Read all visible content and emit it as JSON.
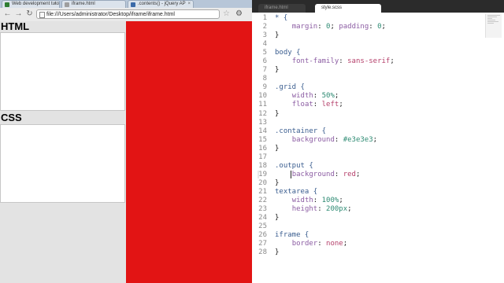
{
  "browser": {
    "tabs": [
      {
        "label": "Web development tuto",
        "favicon_color": "#2e7d32",
        "active": false
      },
      {
        "label": "iframe.html",
        "favicon_color": "#9e9e9e",
        "active": false
      },
      {
        "label": ".contents() - jQuery AP",
        "favicon_color": "#3b6aa8",
        "active": true
      }
    ],
    "tab_close": "×",
    "nav": {
      "back": "←",
      "forward": "→",
      "reload": "↻"
    },
    "url": "file:///Users/administrator/Desktop/iframe/iframe.html",
    "bookmark_icon": "☆",
    "menu_icon": "⚙"
  },
  "page": {
    "html_heading": "HTML",
    "css_heading": "CSS",
    "container_bg": "#e3e3e3",
    "output_bg": "#e21414"
  },
  "editor": {
    "tabs": [
      {
        "label": "iframe.html",
        "active": false
      },
      {
        "label": "style.scss",
        "active": true
      }
    ],
    "lines": [
      [
        {
          "t": "* {",
          "c": "sel"
        }
      ],
      [
        {
          "t": "    "
        },
        {
          "t": "margin",
          "c": "prop"
        },
        {
          "t": ": "
        },
        {
          "t": "0",
          "c": "num"
        },
        {
          "t": "; "
        },
        {
          "t": "padding",
          "c": "prop"
        },
        {
          "t": ": "
        },
        {
          "t": "0",
          "c": "num"
        },
        {
          "t": ";"
        }
      ],
      [
        {
          "t": "}"
        }
      ],
      [
        {
          "t": ""
        }
      ],
      [
        {
          "t": "body {",
          "c": "sel"
        }
      ],
      [
        {
          "t": "    "
        },
        {
          "t": "font-family",
          "c": "prop"
        },
        {
          "t": ": "
        },
        {
          "t": "sans-serif",
          "c": "val"
        },
        {
          "t": ";"
        }
      ],
      [
        {
          "t": "}"
        }
      ],
      [
        {
          "t": ""
        }
      ],
      [
        {
          "t": ".grid {",
          "c": "sel"
        }
      ],
      [
        {
          "t": "    "
        },
        {
          "t": "width",
          "c": "prop"
        },
        {
          "t": ": "
        },
        {
          "t": "50%",
          "c": "num"
        },
        {
          "t": ";"
        }
      ],
      [
        {
          "t": "    "
        },
        {
          "t": "float",
          "c": "prop"
        },
        {
          "t": ": "
        },
        {
          "t": "left",
          "c": "val"
        },
        {
          "t": ";"
        }
      ],
      [
        {
          "t": "}"
        }
      ],
      [
        {
          "t": ""
        }
      ],
      [
        {
          "t": ".container {",
          "c": "sel"
        }
      ],
      [
        {
          "t": "    "
        },
        {
          "t": "background",
          "c": "prop"
        },
        {
          "t": ": "
        },
        {
          "t": "#e3e3e3",
          "c": "num"
        },
        {
          "t": ";"
        }
      ],
      [
        {
          "t": "}"
        }
      ],
      [
        {
          "t": ""
        }
      ],
      [
        {
          "t": ".output {",
          "c": "sel"
        }
      ],
      [
        {
          "t": "    "
        },
        {
          "t": "background",
          "c": "prop"
        },
        {
          "t": ": "
        },
        {
          "t": "red",
          "c": "val"
        },
        {
          "t": ";"
        }
      ],
      [
        {
          "t": "}"
        }
      ],
      [
        {
          "t": "textarea {",
          "c": "sel"
        }
      ],
      [
        {
          "t": "    "
        },
        {
          "t": "width",
          "c": "prop"
        },
        {
          "t": ": "
        },
        {
          "t": "100%",
          "c": "num"
        },
        {
          "t": ";"
        }
      ],
      [
        {
          "t": "    "
        },
        {
          "t": "height",
          "c": "prop"
        },
        {
          "t": ": "
        },
        {
          "t": "200px",
          "c": "num"
        },
        {
          "t": ";"
        }
      ],
      [
        {
          "t": "}"
        }
      ],
      [
        {
          "t": ""
        }
      ],
      [
        {
          "t": "iframe {",
          "c": "sel"
        }
      ],
      [
        {
          "t": "    "
        },
        {
          "t": "border",
          "c": "prop"
        },
        {
          "t": ": "
        },
        {
          "t": "none",
          "c": "val"
        },
        {
          "t": ";"
        }
      ],
      [
        {
          "t": "}"
        }
      ]
    ]
  }
}
